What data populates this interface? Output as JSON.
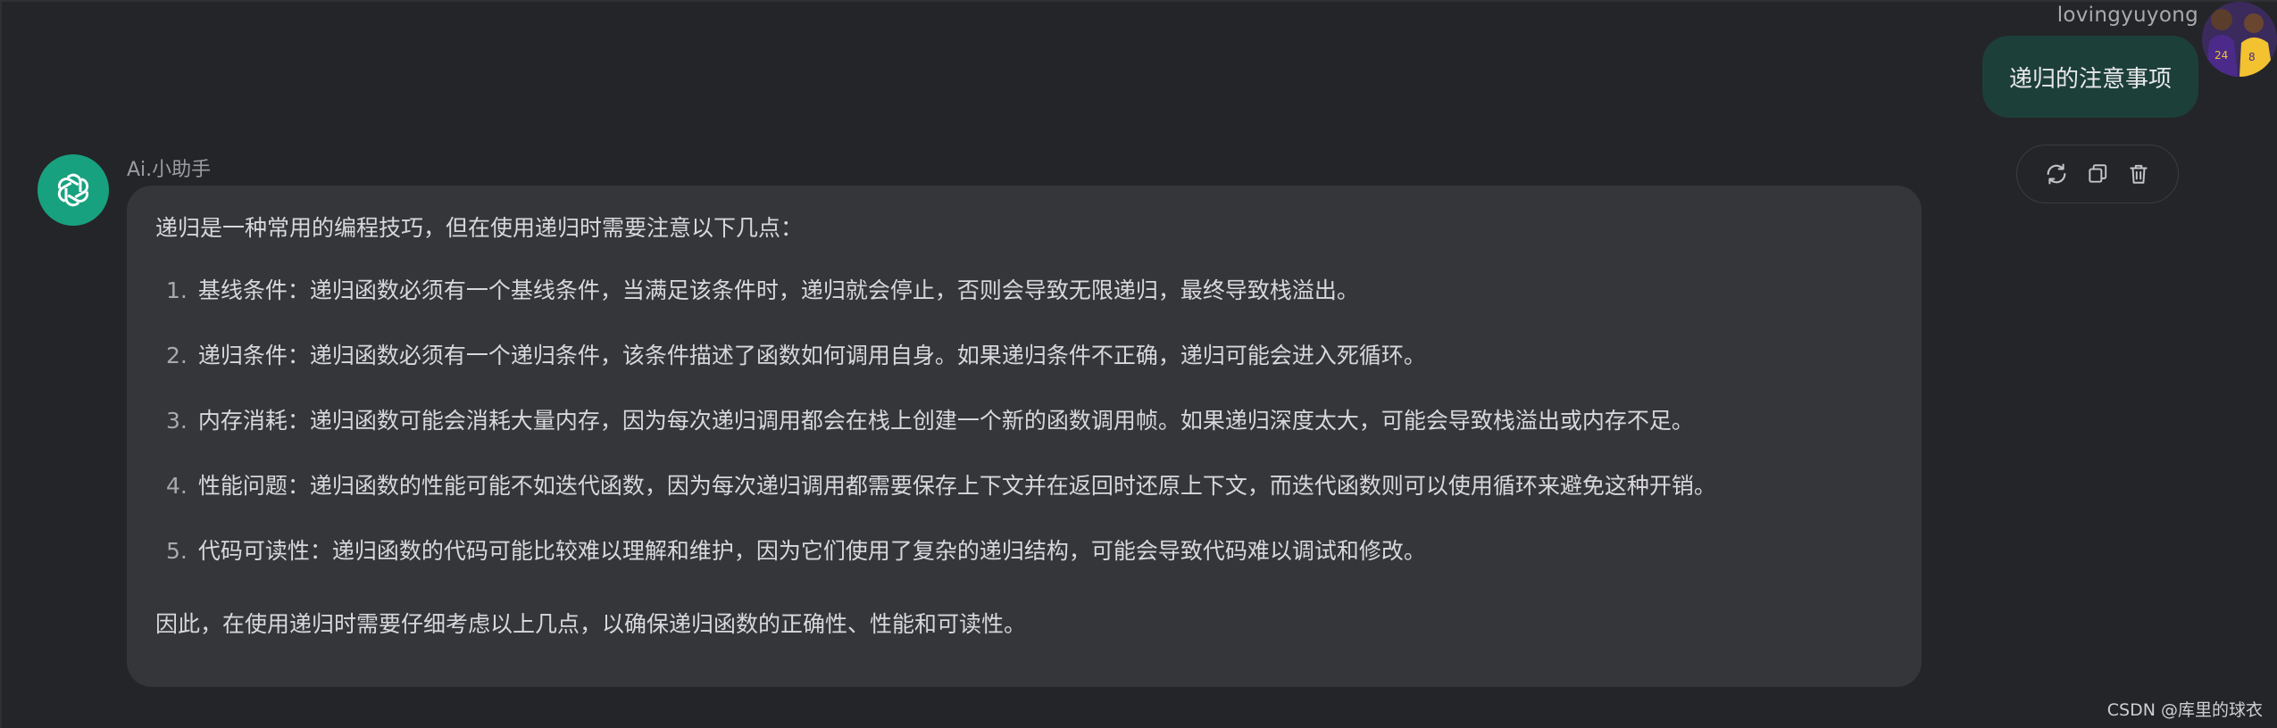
{
  "user": {
    "name": "lovingyuyong",
    "message": "递归的注意事项"
  },
  "icons": {
    "user_avatar": "basketball-player-avatar-icon",
    "assistant_avatar": "chatgpt-logo-icon",
    "regenerate": "refresh-icon",
    "copy": "copy-icon",
    "delete": "trash-icon"
  },
  "colors": {
    "background": "#242528",
    "user_bubble": "#1d3f39",
    "assistant_bubble": "#35363a",
    "assistant_avatar": "#18a17f"
  },
  "assistant": {
    "name": "Ai.小助手",
    "intro": "递归是一种常用的编程技巧，但在使用递归时需要注意以下几点：",
    "points": [
      {
        "num": "1.",
        "text": "基线条件：递归函数必须有一个基线条件，当满足该条件时，递归就会停止，否则会导致无限递归，最终导致栈溢出。"
      },
      {
        "num": "2.",
        "text": "递归条件：递归函数必须有一个递归条件，该条件描述了函数如何调用自身。如果递归条件不正确，递归可能会进入死循环。"
      },
      {
        "num": "3.",
        "text": "内存消耗：递归函数可能会消耗大量内存，因为每次递归调用都会在栈上创建一个新的函数调用帧。如果递归深度太大，可能会导致栈溢出或内存不足。"
      },
      {
        "num": "4.",
        "text": "性能问题：递归函数的性能可能不如迭代函数，因为每次递归调用都需要保存上下文并在返回时还原上下文，而迭代函数则可以使用循环来避免这种开销。"
      },
      {
        "num": "5.",
        "text": "代码可读性：递归函数的代码可能比较难以理解和维护，因为它们使用了复杂的递归结构，可能会导致代码难以调试和修改。"
      }
    ],
    "conclusion": "因此，在使用递归时需要仔细考虑以上几点，以确保递归函数的正确性、性能和可读性。"
  },
  "watermark": "CSDN @库里的球衣"
}
